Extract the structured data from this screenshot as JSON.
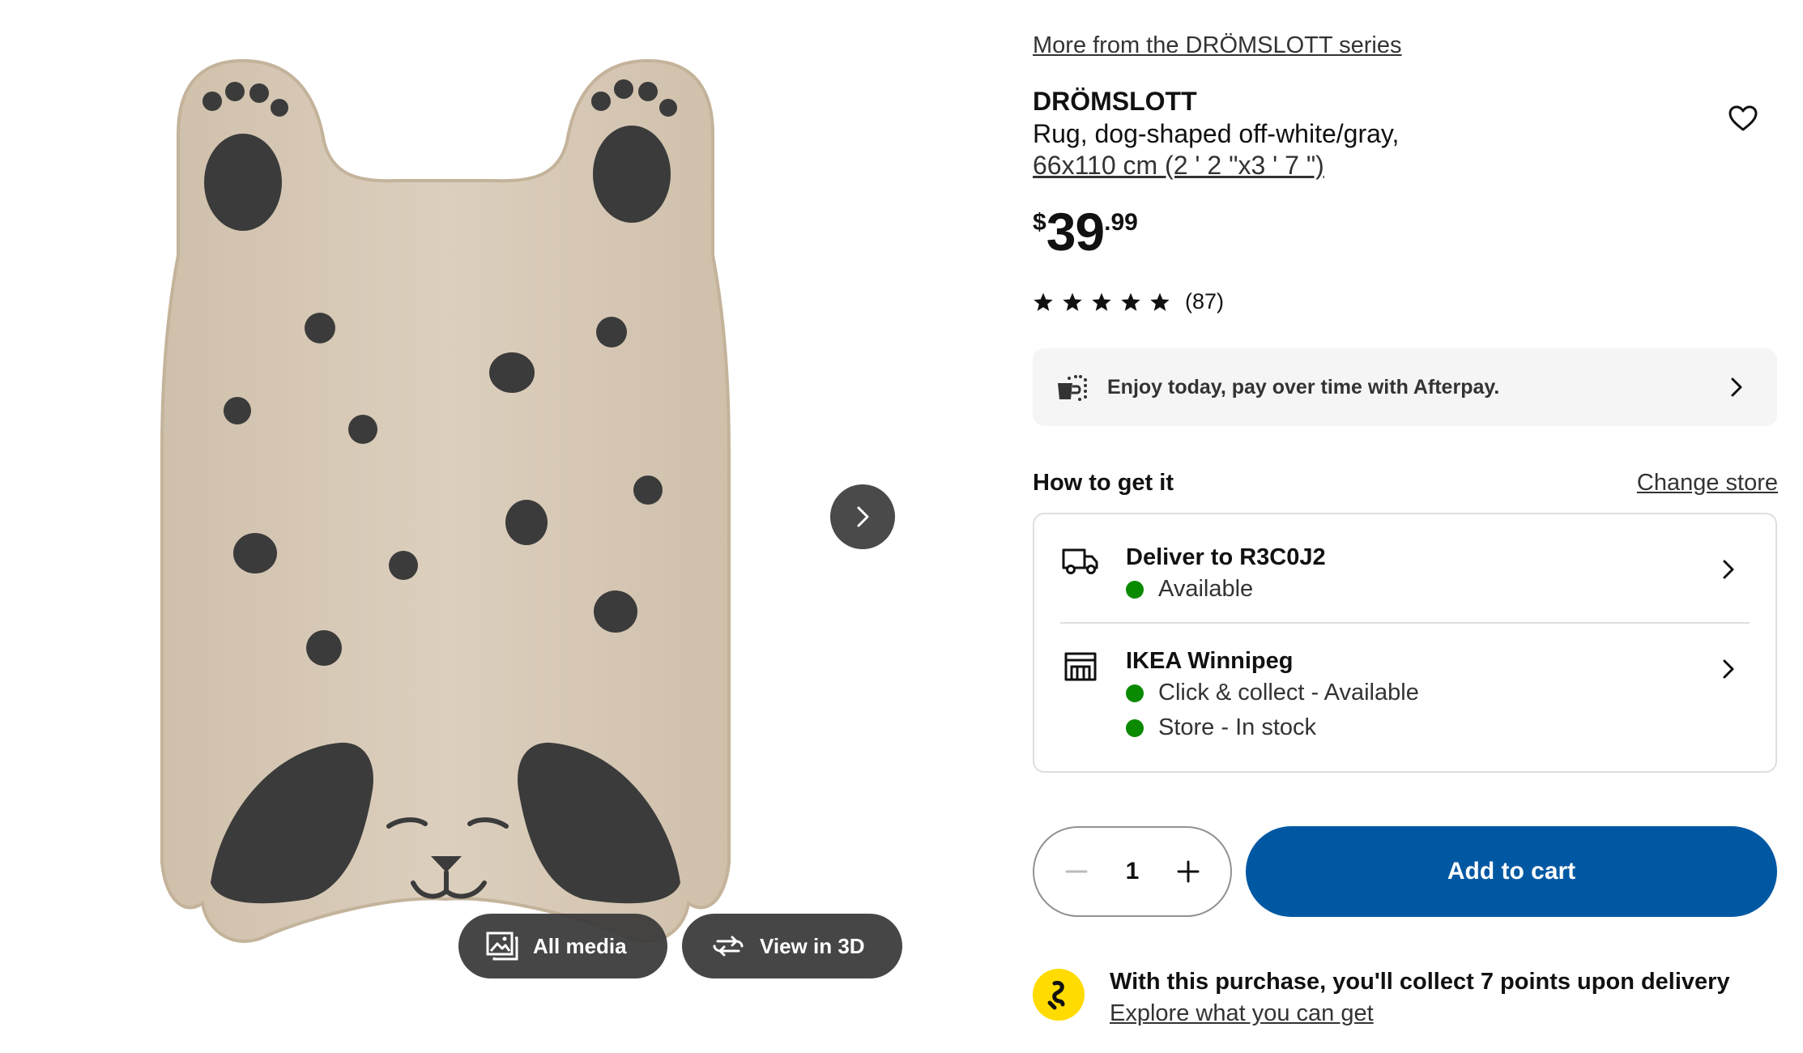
{
  "media": {
    "image_alt": "Dog-shaped rug, off-white with gray spots",
    "all_media_label": "All media",
    "view_3d_label": "View in 3D",
    "all_media_icon": "image-gallery-icon",
    "view_3d_icon": "rotate-3d-icon",
    "next_icon": "chevron-right-icon"
  },
  "product": {
    "series_link": "More from the DRÖMSLOTT series",
    "name": "DRÖMSLOTT",
    "description": "Rug, dog-shaped off-white/gray,",
    "size": "66x110 cm (2 ' 2 \"x3 ' 7 \")",
    "favourite_icon": "heart-outline-icon"
  },
  "price": {
    "currency": "$",
    "integer": "39",
    "decimal": ".99"
  },
  "rating": {
    "stars": 5,
    "count": "(87)"
  },
  "afterpay": {
    "text": "Enjoy today, pay over time with Afterpay.",
    "icon": "afterpay-icon"
  },
  "fulfilment": {
    "title": "How to get it",
    "change_store": "Change store",
    "options": [
      {
        "icon": "delivery-truck-icon",
        "title": "Deliver to R3C0J2",
        "statuses": [
          "Available"
        ]
      },
      {
        "icon": "store-icon",
        "title": "IKEA Winnipeg",
        "statuses": [
          "Click & collect - Available",
          "Store - In stock"
        ]
      }
    ]
  },
  "cart": {
    "quantity": "1",
    "add_label": "Add to cart"
  },
  "family": {
    "text": "With this purchase, you'll collect 7 points upon delivery",
    "link": "Explore what you can get",
    "icon": "ikea-family-icon"
  },
  "colors": {
    "primary_blue": "#0058a3",
    "stock_green": "#0a8a00",
    "family_yellow": "#ffdb00",
    "rug_beige": "#d9cbb8",
    "rug_spot": "#3b3b3b"
  }
}
